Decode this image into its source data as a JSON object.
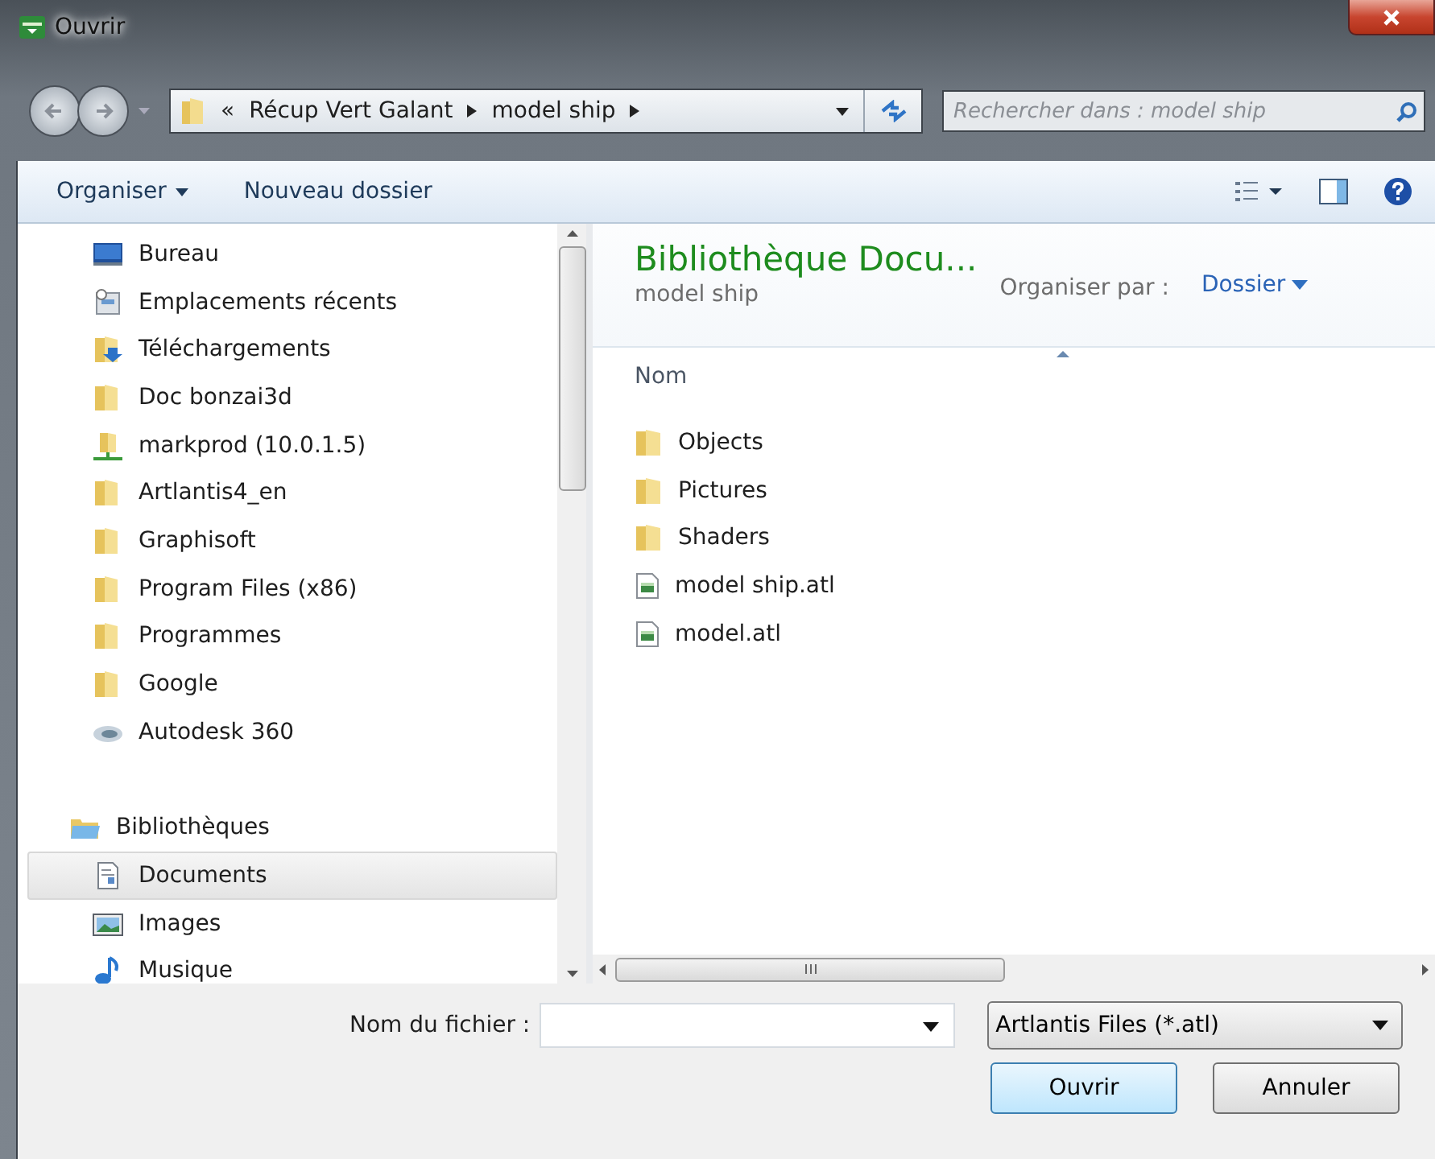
{
  "window": {
    "title": "Ouvrir"
  },
  "address": {
    "overflow": "«",
    "segments": [
      "Récup Vert Galant",
      "model ship"
    ]
  },
  "search": {
    "placeholder": "Rechercher dans : model ship"
  },
  "toolbar": {
    "organize": "Organiser",
    "new_folder": "Nouveau dossier"
  },
  "sidebar": {
    "items": [
      {
        "label": "Bureau",
        "kind": "desktop",
        "selected": false
      },
      {
        "label": "Emplacements récents",
        "kind": "recent",
        "selected": false
      },
      {
        "label": "Téléchargements",
        "kind": "download",
        "selected": false
      },
      {
        "label": "Doc bonzai3d",
        "kind": "folder",
        "selected": false
      },
      {
        "label": "markprod (10.0.1.5)",
        "kind": "network",
        "selected": false
      },
      {
        "label": "Artlantis4_en",
        "kind": "folder",
        "selected": false
      },
      {
        "label": "Graphisoft",
        "kind": "folder",
        "selected": false
      },
      {
        "label": "Program Files (x86)",
        "kind": "folder",
        "selected": false
      },
      {
        "label": "Programmes",
        "kind": "folder",
        "selected": false
      },
      {
        "label": "Google",
        "kind": "folder",
        "selected": false
      },
      {
        "label": "Autodesk 360",
        "kind": "cloud",
        "selected": false
      },
      {
        "label": "Bibliothèques",
        "kind": "library",
        "selected": false,
        "children": [
          {
            "label": "Documents",
            "kind": "document",
            "selected": true
          },
          {
            "label": "Images",
            "kind": "image",
            "selected": false
          },
          {
            "label": "Musique",
            "kind": "music",
            "selected": false
          }
        ]
      }
    ]
  },
  "content": {
    "title": "Bibliothèque Docu...",
    "subtitle": "model ship",
    "arrange_label": "Organiser par :",
    "arrange_value": "Dossier",
    "column": "Nom",
    "files": [
      {
        "name": "Objects",
        "kind": "folder"
      },
      {
        "name": "Pictures",
        "kind": "folder"
      },
      {
        "name": "Shaders",
        "kind": "folder"
      },
      {
        "name": "model ship.atl",
        "kind": "file"
      },
      {
        "name": "model.atl",
        "kind": "file"
      }
    ]
  },
  "footer": {
    "filename_label": "Nom du fichier :",
    "filter": "Artlantis Files (*.atl)",
    "open": "Ouvrir",
    "cancel": "Annuler"
  }
}
